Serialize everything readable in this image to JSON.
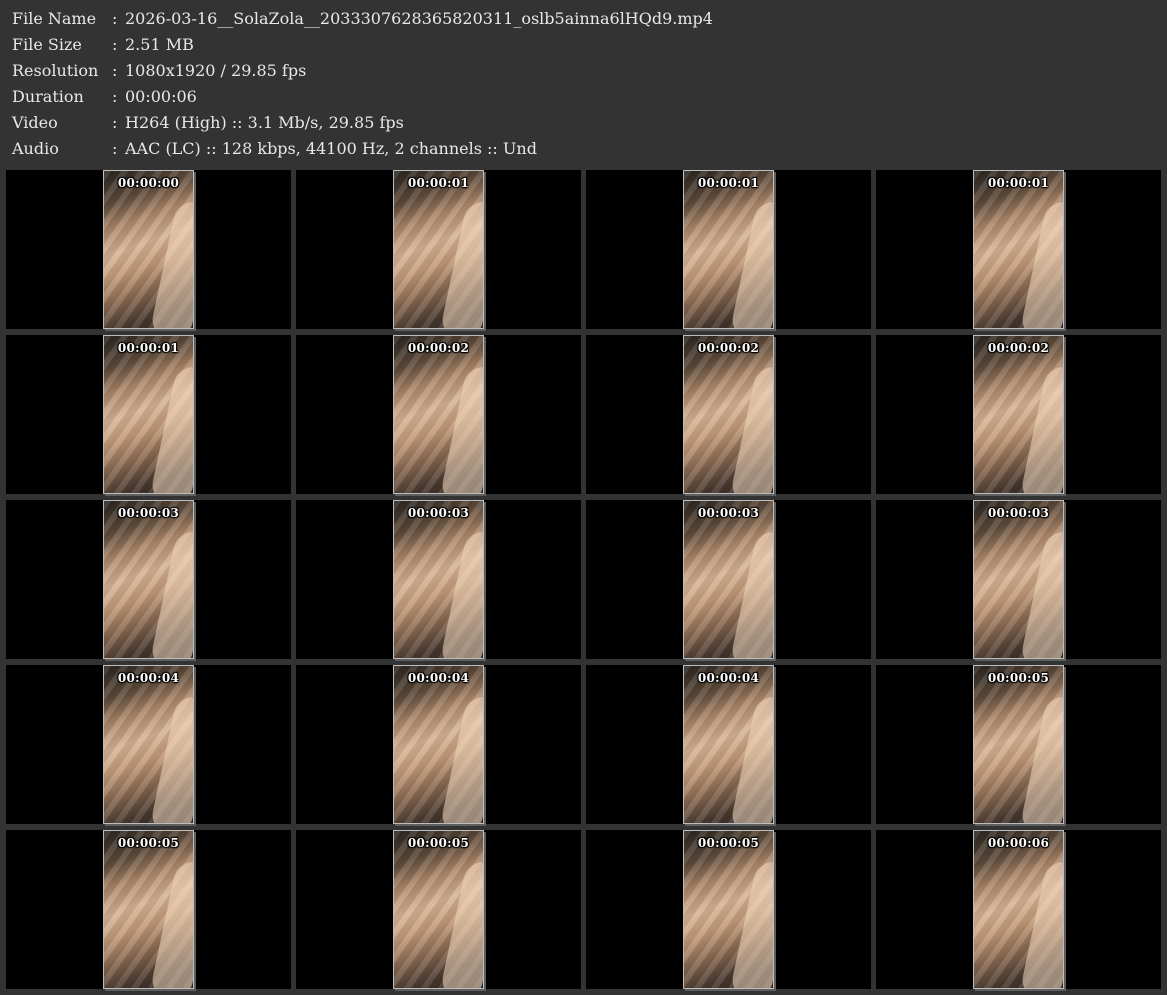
{
  "info": [
    {
      "label": "File Name",
      "value": "2026-03-16__SolaZola__2033307628365820311_oslb5ainna6lHQd9.mp4"
    },
    {
      "label": "File Size",
      "value": "2.51 MB"
    },
    {
      "label": "Resolution",
      "value": "1080x1920 / 29.85 fps"
    },
    {
      "label": "Duration",
      "value": "00:00:06"
    },
    {
      "label": "Video",
      "value": "H264 (High) :: 3.1 Mb/s, 29.85 fps"
    },
    {
      "label": "Audio",
      "value": "AAC (LC) :: 128 kbps, 44100 Hz, 2 channels :: Und"
    }
  ],
  "separator": ":",
  "thumbnails": [
    "00:00:00",
    "00:00:01",
    "00:00:01",
    "00:00:01",
    "00:00:01",
    "00:00:02",
    "00:00:02",
    "00:00:02",
    "00:00:03",
    "00:00:03",
    "00:00:03",
    "00:00:03",
    "00:00:04",
    "00:00:04",
    "00:00:04",
    "00:00:05",
    "00:00:05",
    "00:00:05",
    "00:00:05",
    "00:00:06"
  ],
  "colors": {
    "background": "#333333",
    "cell_background": "#000000",
    "text": "#e8e8e8"
  }
}
